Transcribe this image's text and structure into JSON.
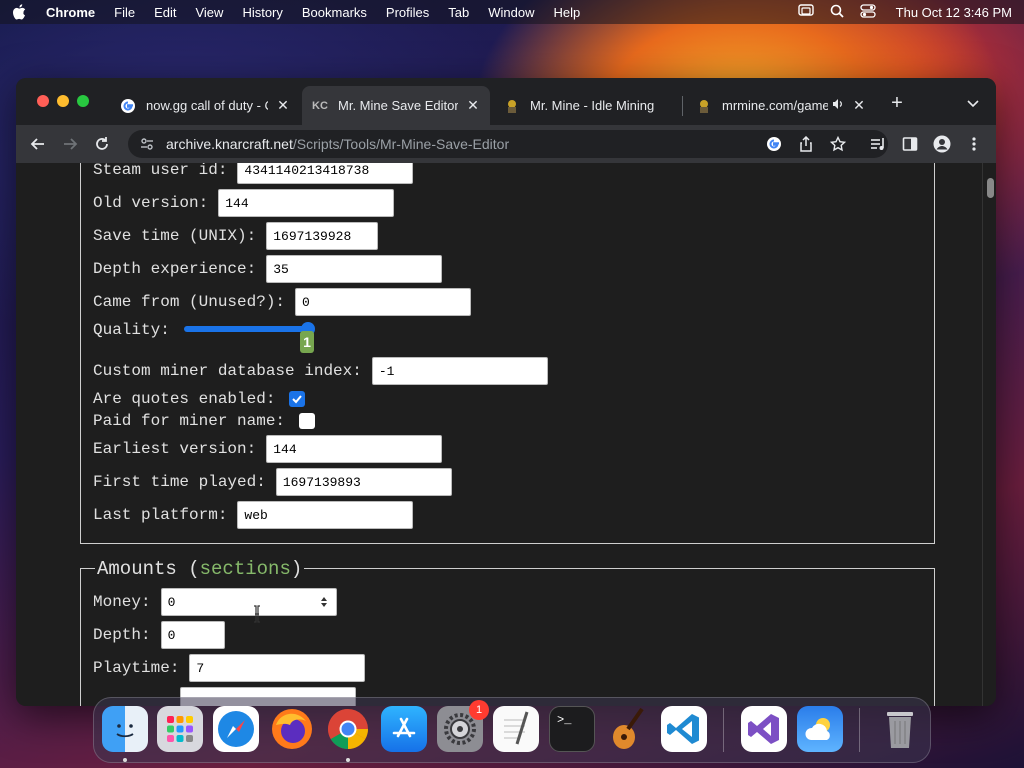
{
  "menubar": {
    "app_name": "Chrome",
    "items": [
      "File",
      "Edit",
      "View",
      "History",
      "Bookmarks",
      "Profiles",
      "Tab",
      "Window",
      "Help"
    ],
    "clock": "Thu Oct 12  3:46 PM"
  },
  "tabs": [
    {
      "title": "now.gg call of duty - C",
      "favicon": "google-icon",
      "active": false
    },
    {
      "title": "Mr. Mine Save Editor",
      "favicon": "kc-icon",
      "active": true
    },
    {
      "title": "Mr. Mine - Idle Mining",
      "favicon": "miner-icon",
      "active": false
    },
    {
      "title": "mrmine.com/game",
      "favicon": "miner-icon",
      "active": false,
      "audio": true
    }
  ],
  "address_bar": {
    "host": "archive.knarcraft.net",
    "path": "/Scripts/Tools/Mr-Mine-Save-Editor"
  },
  "form": {
    "steam_user_id": {
      "label": "Steam user id:",
      "value": "4341140213418738"
    },
    "old_version": {
      "label": "Old version:",
      "value": "144"
    },
    "save_time": {
      "label": "Save time (UNIX):",
      "value": "1697139928"
    },
    "depth_experience": {
      "label": "Depth experience:",
      "value": "35"
    },
    "came_from": {
      "label": "Came from (Unused?):",
      "value": "0"
    },
    "quality": {
      "label": "Quality:",
      "value": "1",
      "level": 1.0
    },
    "custom_miner_index": {
      "label": "Custom miner database index:",
      "value": "-1"
    },
    "quotes_enabled": {
      "label": "Are quotes enabled:",
      "checked": true
    },
    "paid_miner_name": {
      "label": "Paid for miner name:",
      "checked": false
    },
    "earliest_version": {
      "label": "Earliest version:",
      "value": "144"
    },
    "first_time_played": {
      "label": "First time played:",
      "value": "1697139893"
    },
    "last_platform": {
      "label": "Last platform:",
      "value": "web"
    }
  },
  "amounts": {
    "legend_prefix": "Amounts (",
    "legend_link": "sections",
    "legend_suffix": ")",
    "money": {
      "label": "Money:",
      "value": "0"
    },
    "depth": {
      "label": "Depth:",
      "value": "0"
    },
    "playtime": {
      "label": "Playtime:",
      "value": "7"
    }
  },
  "dock": [
    "Finder",
    "Launchpad",
    "Safari",
    "Firefox",
    "Chrome",
    "App Store",
    "System Settings",
    "TextEdit",
    "Terminal",
    "GarageBand",
    "Visual Studio Code",
    "Visual Studio",
    "Weather",
    "Trash"
  ],
  "dock_badge": "1",
  "colors": {
    "accent": "#1a73e8",
    "link_green": "#86b96a",
    "page_bg": "#1e1e1e"
  }
}
